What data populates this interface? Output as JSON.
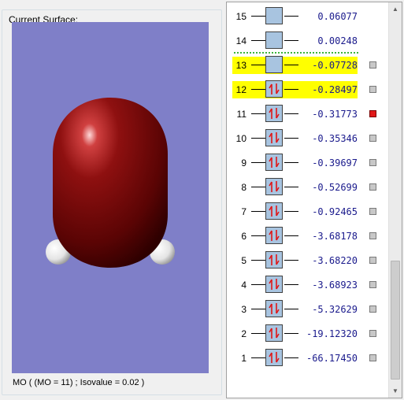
{
  "surface": {
    "group_label": "Current Surface:",
    "caption": "MO ( (MO = 11) ; Isovalue = 0.02 )",
    "background_color": "#7f7fc8",
    "lobe_color": "#8a0e0e",
    "atom_color": "#f2f2f2"
  },
  "orbitals": [
    {
      "num": "15",
      "energy": "0.06077",
      "occupancy": "empty",
      "highlight": false,
      "checkbox": "none"
    },
    {
      "num": "14",
      "energy": "0.00248",
      "occupancy": "empty",
      "highlight": false,
      "checkbox": "none"
    },
    {
      "num": "13",
      "energy": "-0.07728",
      "occupancy": "empty",
      "highlight": true,
      "checkbox": "unchecked"
    },
    {
      "num": "12",
      "energy": "-0.28497",
      "occupancy": "paired",
      "highlight": true,
      "checkbox": "unchecked"
    },
    {
      "num": "11",
      "energy": "-0.31773",
      "occupancy": "paired",
      "highlight": false,
      "checkbox": "selected"
    },
    {
      "num": "10",
      "energy": "-0.35346",
      "occupancy": "paired",
      "highlight": false,
      "checkbox": "unchecked"
    },
    {
      "num": "9",
      "energy": "-0.39697",
      "occupancy": "paired",
      "highlight": false,
      "checkbox": "unchecked"
    },
    {
      "num": "8",
      "energy": "-0.52699",
      "occupancy": "paired",
      "highlight": false,
      "checkbox": "unchecked"
    },
    {
      "num": "7",
      "energy": "-0.92465",
      "occupancy": "paired",
      "highlight": false,
      "checkbox": "unchecked"
    },
    {
      "num": "6",
      "energy": "-3.68178",
      "occupancy": "paired",
      "highlight": false,
      "checkbox": "unchecked"
    },
    {
      "num": "5",
      "energy": "-3.68220",
      "occupancy": "paired",
      "highlight": false,
      "checkbox": "unchecked"
    },
    {
      "num": "4",
      "energy": "-3.68923",
      "occupancy": "paired",
      "highlight": false,
      "checkbox": "unchecked"
    },
    {
      "num": "3",
      "energy": "-5.32629",
      "occupancy": "paired",
      "highlight": false,
      "checkbox": "unchecked"
    },
    {
      "num": "2",
      "energy": "-19.12320",
      "occupancy": "paired",
      "highlight": false,
      "checkbox": "unchecked"
    },
    {
      "num": "1",
      "energy": "-66.17450",
      "occupancy": "paired",
      "highlight": false,
      "checkbox": "unchecked"
    }
  ],
  "colors": {
    "highlight": "#ffff00",
    "homo_lumo_separator": "#3cb43c",
    "energy_text": "#1a1a8c",
    "electron_arrow": "#e01818",
    "orbital_box": "#a8c4e0",
    "selected_checkbox": "#e01818"
  }
}
